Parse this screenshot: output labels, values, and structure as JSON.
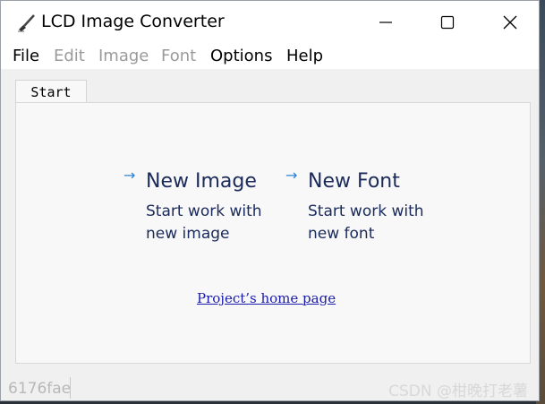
{
  "window": {
    "title": "LCD Image Converter"
  },
  "menu": {
    "items": [
      {
        "label": "File",
        "enabled": true
      },
      {
        "label": "Edit",
        "enabled": false
      },
      {
        "label": "Image",
        "enabled": false
      },
      {
        "label": "Font",
        "enabled": false
      },
      {
        "label": "Options",
        "enabled": true
      },
      {
        "label": "Help",
        "enabled": true
      }
    ]
  },
  "tabs": [
    {
      "label": "Start",
      "active": true
    }
  ],
  "start": {
    "new_image": {
      "arrow": "→",
      "title": "New Image",
      "desc_line1": "Start work with",
      "desc_line2": "new image"
    },
    "new_font": {
      "arrow": "→",
      "title": "New Font",
      "desc_line1": "Start work with",
      "desc_line2": "new font"
    },
    "home_link": "Project’s home page"
  },
  "statusbar": {
    "text": "6176fae"
  },
  "watermark": "CSDN @柑晚打老薯",
  "icons": {
    "app": "brush-icon",
    "minimize": "minimize-icon",
    "maximize": "maximize-icon",
    "close": "close-icon",
    "arrow": "arrow-right-icon"
  },
  "colors": {
    "link": "#1a1aaa",
    "arrow": "#2b84d6",
    "action_text": "#1a2a5a"
  }
}
